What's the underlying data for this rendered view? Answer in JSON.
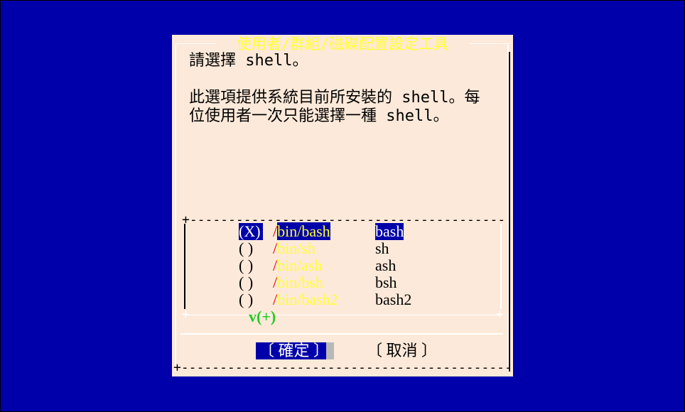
{
  "dialog": {
    "title": "使用者/群組/磁碟配置設定工具",
    "prompt_line1": "請選擇 shell。",
    "prompt_line2": "此選項提供系統目前所安裝的 shell。每",
    "prompt_line3": "位使用者一次只能選擇一種 shell。",
    "frame_bottom": "+--------------------------------------------+",
    "list_frame_top": "+--------------------------------------------+"
  },
  "options": [
    {
      "radio": "(X)",
      "slash": "/",
      "path": "bin/bash",
      "name": "bash",
      "selected": true
    },
    {
      "radio": "( )",
      "slash": "/",
      "path": "bin/sh",
      "name": "sh",
      "selected": false
    },
    {
      "radio": "( )",
      "slash": "/",
      "path": "bin/ash",
      "name": "ash",
      "selected": false
    },
    {
      "radio": "( )",
      "slash": "/",
      "path": "bin/bsh",
      "name": "bsh",
      "selected": false
    },
    {
      "radio": "( )",
      "slash": "/",
      "path": "bin/bash2",
      "name": "bash2",
      "selected": false
    }
  ],
  "scroll_indicator": "v(+)",
  "buttons": {
    "ok": "〔 確定 〕",
    "cancel": "〔 取消 〕"
  },
  "colors": {
    "background": "#0000aa",
    "dialog": "#fde9d9",
    "title": "#ffff33",
    "path": "#ffff33",
    "slash": "#dd0000",
    "scroll": "#22cc22"
  }
}
